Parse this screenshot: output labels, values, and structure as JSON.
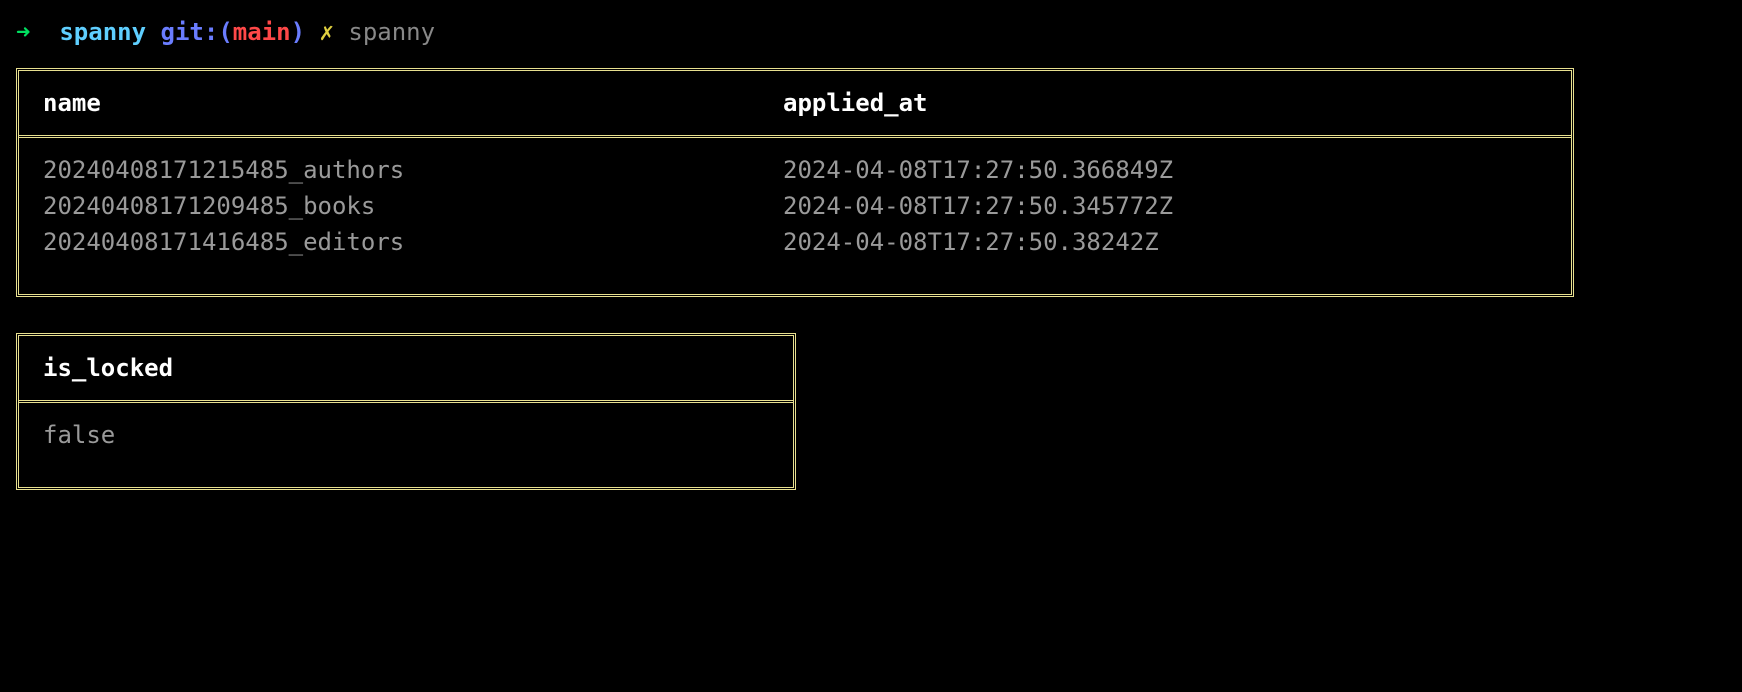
{
  "prompt": {
    "arrow": "➜",
    "cwd": "spanny",
    "git_label": "git:(",
    "git_branch": "main",
    "git_close": ")",
    "dirty": "✗",
    "command": "spanny"
  },
  "migrations_table": {
    "headers": {
      "name": "name",
      "applied_at": "applied_at"
    },
    "rows": [
      {
        "name": "20240408171215485_authors",
        "applied_at": "2024-04-08T17:27:50.366849Z"
      },
      {
        "name": "20240408171209485_books",
        "applied_at": "2024-04-08T17:27:50.345772Z"
      },
      {
        "name": "20240408171416485_editors",
        "applied_at": "2024-04-08T17:27:50.38242Z"
      }
    ]
  },
  "lock_table": {
    "headers": {
      "is_locked": "is_locked"
    },
    "rows": [
      {
        "is_locked": "false"
      }
    ]
  }
}
